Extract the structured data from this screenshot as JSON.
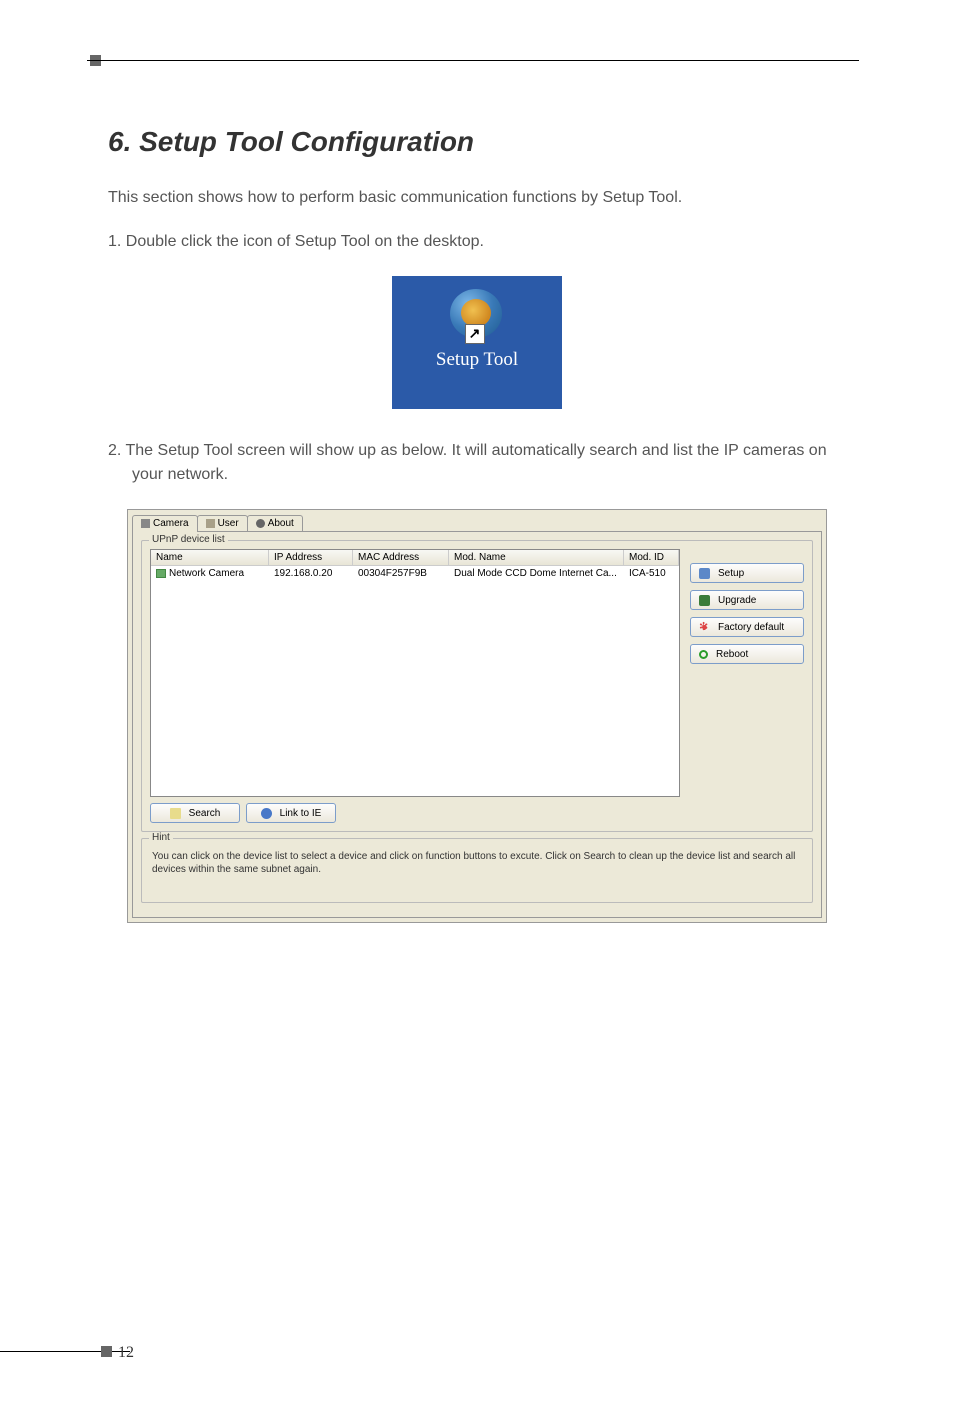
{
  "heading": "6. Setup Tool Configuration",
  "intro": "This section shows how to perform basic communication functions by Setup Tool.",
  "step1": "1. Double click the icon of Setup Tool on the desktop.",
  "icon_label": "Setup Tool",
  "shortcut_symbol": "↗",
  "step2": "2. The Setup Tool screen will show up as below. It will automatically search and list the IP cameras on your network.",
  "tabs": {
    "camera": "Camera",
    "user": "User",
    "about": "About"
  },
  "groupbox": {
    "upnp": "UPnP device list",
    "hint": "Hint"
  },
  "columns": {
    "name": "Name",
    "ip": "IP Address",
    "mac": "MAC Address",
    "mod_name": "Mod. Name",
    "mod_id": "Mod. ID"
  },
  "device_row": {
    "name": "Network Camera",
    "ip": "192.168.0.20",
    "mac": "00304F257F9B",
    "mod_name": "Dual Mode CCD Dome Internet Ca...",
    "mod_id": "ICA-510"
  },
  "buttons": {
    "setup": "Setup",
    "upgrade": "Upgrade",
    "factory": "Factory default",
    "reboot": "Reboot",
    "search": "Search",
    "link": "Link to IE"
  },
  "hint_text": "You can click on the device list to select a device and click on function buttons to excute. Click on Search to clean up the device list and search all devices within the same subnet again.",
  "page_number": "12"
}
